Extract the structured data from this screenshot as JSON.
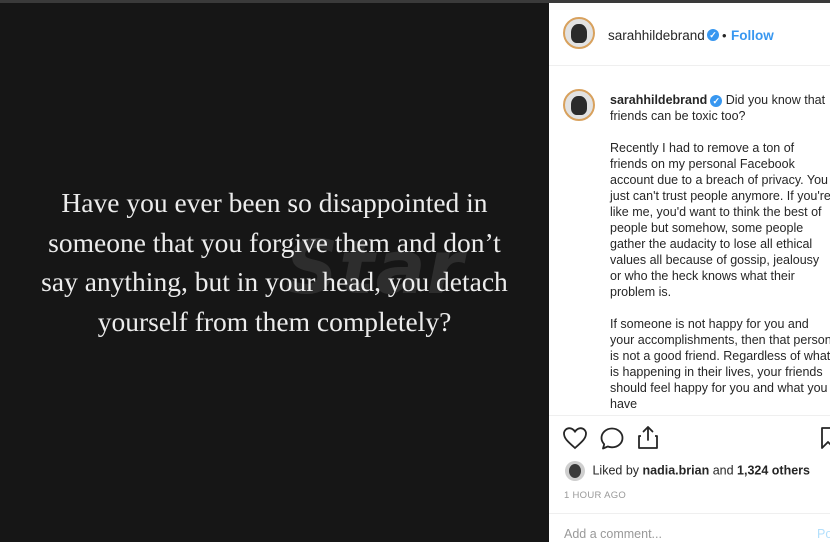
{
  "post": {
    "quote": "Have you ever been so disappointed in someone that you forgive them and don’t say anything, but in your head, you detach yourself from them completely?",
    "watermark": "Star"
  },
  "header": {
    "username": "sarahhildebrand",
    "separator": "•",
    "follow_label": "Follow"
  },
  "caption": {
    "username": "sarahhildebrand",
    "lead": "Did you know that friends can be toxic too?",
    "paragraph1": "Recently I had to remove a ton of friends on my personal Facebook account due to a breach of privacy. You just can't trust people anymore. If you're like me, you'd want to think the best of people but somehow, some people gather the audacity to lose all ethical values all because of gossip, jealousy or who the heck knows what their problem is.",
    "paragraph2": "If someone is not happy for you and your accomplishments, then that person is not a good friend. Regardless of what is happening in their lives, your friends should feel happy for you and what you have"
  },
  "actions": {
    "liked_prefix": "Liked by",
    "liked_user": "nadia.brian",
    "liked_and": "and",
    "liked_others": "1,324 others",
    "timestamp": "1 HOUR AGO",
    "comment_placeholder": "Add a comment...",
    "post_label": "Po"
  },
  "colors": {
    "link_blue": "#3897f0",
    "verified_blue": "#3897f0",
    "story_ring": "#d8a15d"
  },
  "icons": [
    "verified-badge-icon",
    "heart-icon",
    "comment-icon",
    "share-icon",
    "bookmark-icon"
  ]
}
